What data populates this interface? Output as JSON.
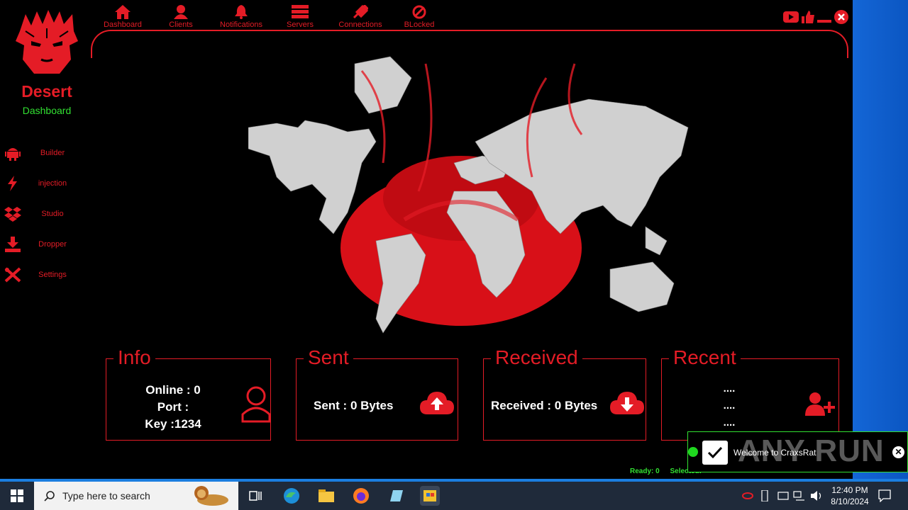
{
  "brand": {
    "name": "Desert",
    "subtitle": "Dashboard"
  },
  "sidebar": {
    "items": [
      {
        "label": "Builder",
        "icon": "android-icon"
      },
      {
        "label": "injection",
        "icon": "lightning-icon"
      },
      {
        "label": "Studio",
        "icon": "dropbox-icon"
      },
      {
        "label": "Dropper",
        "icon": "download-tray-icon"
      },
      {
        "label": "Settings",
        "icon": "tools-icon"
      }
    ]
  },
  "topnav": {
    "items": [
      {
        "label": "Dashboard",
        "icon": "home-icon"
      },
      {
        "label": "Clients",
        "icon": "user-icon"
      },
      {
        "label": "Notifications",
        "icon": "bell-icon"
      },
      {
        "label": "Servers",
        "icon": "servers-icon"
      },
      {
        "label": "Connections",
        "icon": "plug-icon"
      },
      {
        "label": "BLocked",
        "icon": "blocked-icon"
      }
    ]
  },
  "cards": {
    "info": {
      "title": "Info",
      "online": "Online : 0",
      "port": "Port :",
      "key": "Key :1234"
    },
    "sent": {
      "title": "Sent",
      "text": "Sent : 0 Bytes"
    },
    "received": {
      "title": "Received",
      "text": "Received : 0 Bytes"
    },
    "recent": {
      "title": "Recent",
      "lines": [
        "....",
        "....",
        "...."
      ]
    }
  },
  "statusbar": {
    "ready": "Ready: 0",
    "selected": "Selected:"
  },
  "toast": {
    "message": "Welcome to CraxsRat"
  },
  "watermark": {
    "text": "ANY RUN"
  },
  "taskbar": {
    "search_placeholder": "Type here to search",
    "time": "12:40 PM",
    "date": "8/10/2024"
  },
  "colors": {
    "accent": "#e41c26",
    "success": "#32e032",
    "background": "#000000"
  }
}
